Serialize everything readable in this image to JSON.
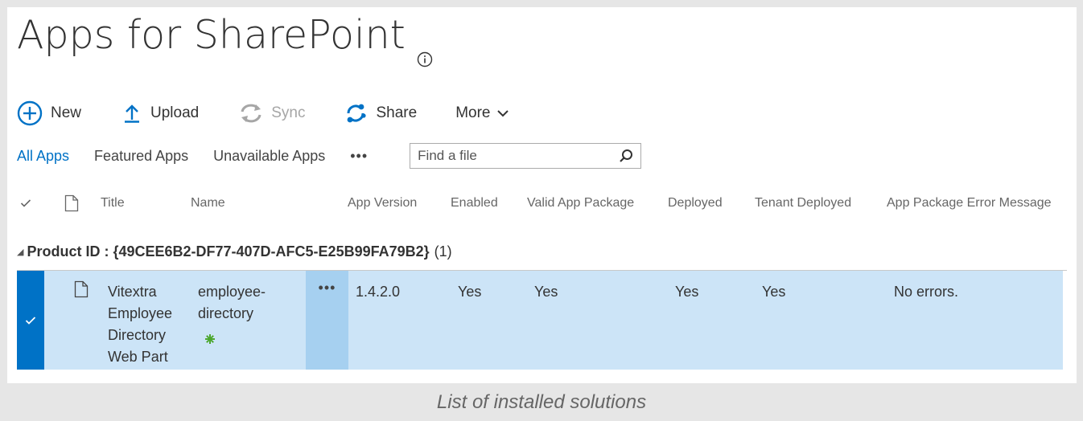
{
  "page": {
    "title": "Apps for SharePoint",
    "caption": "List of installed solutions"
  },
  "toolbar": {
    "new_label": "New",
    "upload_label": "Upload",
    "sync_label": "Sync",
    "share_label": "Share",
    "more_label": "More"
  },
  "views": {
    "all": "All Apps",
    "featured": "Featured Apps",
    "unavailable": "Unavailable Apps",
    "more": "•••"
  },
  "search": {
    "placeholder": "Find a file"
  },
  "columns": {
    "title": "Title",
    "name": "Name",
    "app_version": "App Version",
    "enabled": "Enabled",
    "valid_app_package": "Valid App Package",
    "deployed": "Deployed",
    "tenant_deployed": "Tenant Deployed",
    "error_message": "App Package Error Message"
  },
  "group": {
    "label": "Product ID : {49CEE6B2-DF77-407D-AFC5-E25B99FA79B2}",
    "count": "(1)"
  },
  "rows": [
    {
      "title": "Vitextra Employee Directory Web Part",
      "name": "employee-directory",
      "ellipsis": "•••",
      "app_version": "1.4.2.0",
      "enabled": "Yes",
      "valid_app_package": "Yes",
      "deployed": "Yes",
      "tenant_deployed": "Yes",
      "error_message": "No errors."
    }
  ],
  "colors": {
    "accent": "#0072c6",
    "row_selected": "#cce4f7",
    "ellipsis_cell": "#a6d0f0",
    "new_badge": "#4ca72e"
  }
}
